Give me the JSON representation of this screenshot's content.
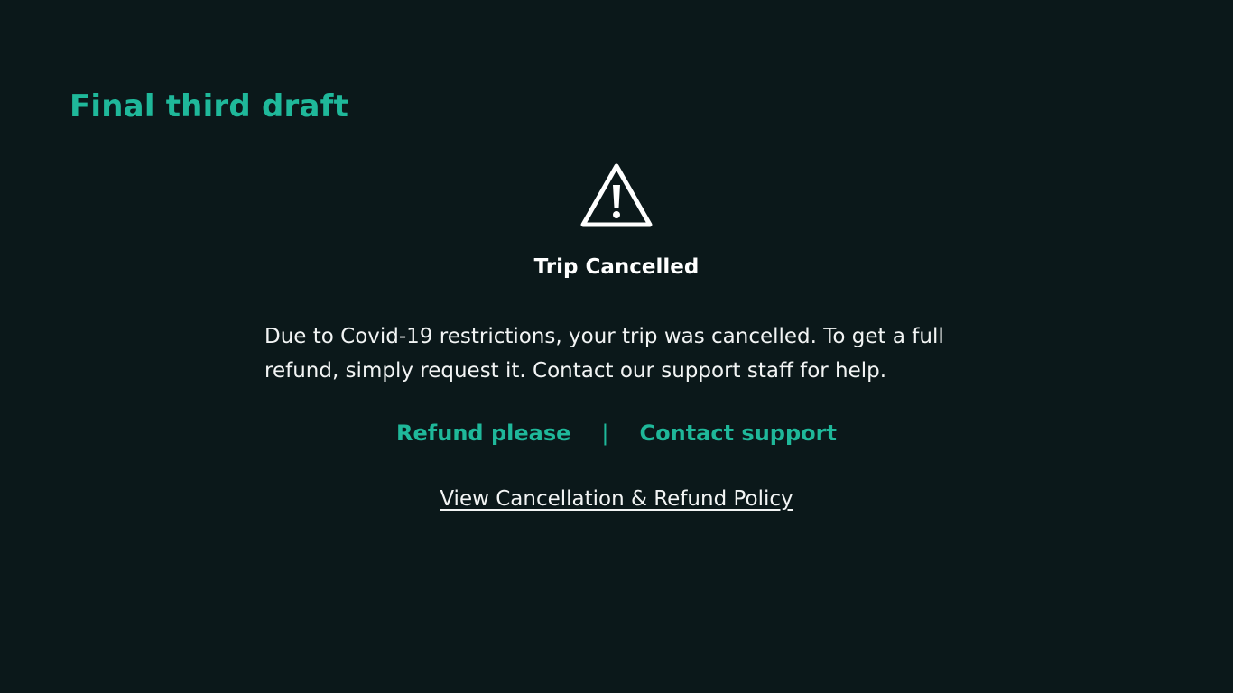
{
  "page": {
    "draft_title": "Final third draft"
  },
  "card": {
    "icon": "warning-icon",
    "title": "Trip Cancelled",
    "message": "Due to Covid-19 restrictions, your trip was cancelled. To get a full refund, simply request it. Contact our support staff for help.",
    "refund_label": "Refund please",
    "separator": "|",
    "support_label": "Contact support",
    "policy_label": "View Cancellation & Refund Policy"
  },
  "colors": {
    "background": "#0b181a",
    "accent": "#1fb89a",
    "text": "#f2f4f4"
  }
}
